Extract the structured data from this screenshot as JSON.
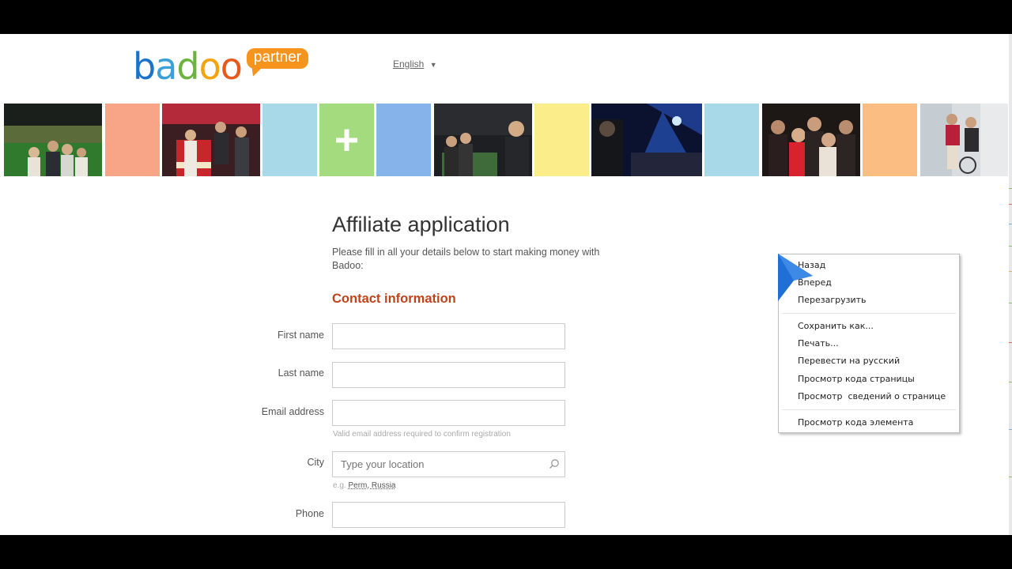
{
  "header": {
    "logo_brand": "badoo",
    "logo_tag": "partner",
    "language": "English",
    "language_arrow": "▼"
  },
  "strip_tiles": [
    {
      "kind": "photo",
      "scene": "stadium-friends"
    },
    {
      "kind": "color",
      "color": "#f8a587"
    },
    {
      "kind": "photo",
      "scene": "bar-counter"
    },
    {
      "kind": "color",
      "color": "#a7d9e8"
    },
    {
      "kind": "plus",
      "color": "#a3db7e"
    },
    {
      "kind": "color",
      "color": "#85b3ea"
    },
    {
      "kind": "photo",
      "scene": "foosball"
    },
    {
      "kind": "color",
      "color": "#fbee8a"
    },
    {
      "kind": "photo",
      "scene": "dj-club"
    },
    {
      "kind": "color",
      "color": "#a7d9e8"
    },
    {
      "kind": "photo",
      "scene": "girls-party"
    },
    {
      "kind": "color",
      "color": "#fbbd82"
    },
    {
      "kind": "photo",
      "scene": "street-girls"
    }
  ],
  "form": {
    "title": "Affiliate application",
    "intro": "Please fill in all your details below to start making money with Badoo:",
    "section_title": "Contact information",
    "first_name_label": "First name",
    "last_name_label": "Last name",
    "email_label": "Email address",
    "email_hint": "Valid email address required to confirm registration",
    "city_label": "City",
    "city_placeholder": "Type your location",
    "city_hint_prefix": "e.g.",
    "city_hint_example": "Perm, Russia",
    "phone_label": "Phone"
  },
  "context_menu": {
    "items": [
      "Назад",
      "Вперед",
      "Перезагрузить",
      "Сохранить как...",
      "Печать...",
      "Перевести на русский",
      "Просмотр кода страницы",
      "Просмотр  сведений о странице",
      "Просмотр кода элемента"
    ]
  },
  "colors": {
    "accent_orange": "#f7941d",
    "section_red": "#c0441a",
    "logo_blue": "#1a73c9"
  }
}
